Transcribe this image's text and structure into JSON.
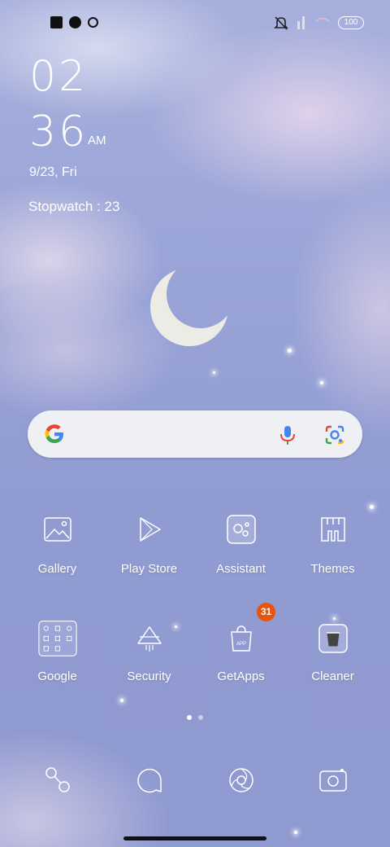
{
  "status_bar": {
    "left_icons": [
      "square-notification-icon",
      "app-notification-icon",
      "lock-notification-icon"
    ],
    "right_icons": [
      "mute-icon",
      "signal-icon",
      "wifi-icon"
    ],
    "battery": "100"
  },
  "lockclock": {
    "hour": "02",
    "minute": "36",
    "ampm": "AM",
    "date": "9/23,  Fri",
    "stopwatch": "Stopwatch : 23"
  },
  "search": {
    "icons": [
      "google-g-icon",
      "mic-icon",
      "google-lens-icon"
    ]
  },
  "apps_row1": [
    {
      "label": "Gallery",
      "icon": "gallery-icon"
    },
    {
      "label": "Play Store",
      "icon": "play-store-icon"
    },
    {
      "label": "Assistant",
      "icon": "assistant-icon"
    },
    {
      "label": "Themes",
      "icon": "themes-icon"
    }
  ],
  "apps_row2": [
    {
      "label": "Google",
      "icon": "google-folder-icon"
    },
    {
      "label": "Security",
      "icon": "security-icon"
    },
    {
      "label": "GetApps",
      "icon": "getapps-icon",
      "badge": "31"
    },
    {
      "label": "Cleaner",
      "icon": "cleaner-icon"
    }
  ],
  "page_indicator": {
    "pages": 2,
    "active": 1
  },
  "dock": [
    "phone-icon",
    "messages-icon",
    "browser-icon",
    "camera-icon"
  ],
  "colors": {
    "badge": "#e8540f",
    "text": "#ffffff"
  }
}
